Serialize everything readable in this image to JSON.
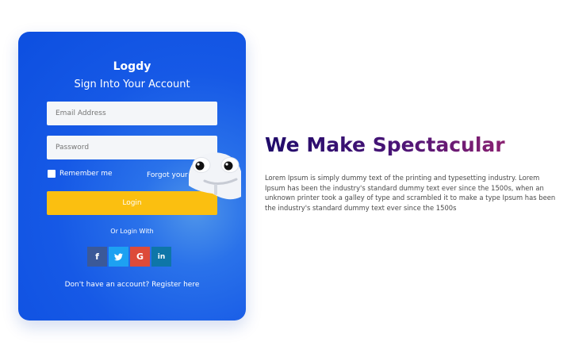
{
  "login_card": {
    "brand": "Logdy",
    "subtitle": "Sign Into Your Account",
    "email_placeholder": "Email Address",
    "password_placeholder": "Password",
    "remember_label": "Remember me",
    "forgot_label": "Forgot your password?",
    "login_label": "Login",
    "or_login_with": "Or Login With",
    "socials": [
      {
        "name": "facebook",
        "glyph": "f",
        "color": "#3b5998"
      },
      {
        "name": "twitter",
        "glyph": "🐦",
        "color": "#1da1f2"
      },
      {
        "name": "google",
        "glyph": "G",
        "color": "#dd4b39"
      },
      {
        "name": "linkedin",
        "glyph": "in",
        "color": "#0e76a8"
      }
    ],
    "no_account_text": "Don't have an account?",
    "register_label": "Register here"
  },
  "hero": {
    "headline": "We Make Spectacular",
    "body": "Lorem Ipsum is simply dummy text of the printing and typesetting industry. Lorem Ipsum has been the industry's standard dummy text ever since the 1500s, when an unknown printer took a galley of type and scrambled it to make a type Ipsum has been the industry's standard dummy text ever since the 1500s"
  },
  "colors": {
    "card_blue": "#1659e6",
    "login_yellow": "#fbbf10",
    "headline_start": "#1f0b6a",
    "headline_end": "#8a2171"
  }
}
